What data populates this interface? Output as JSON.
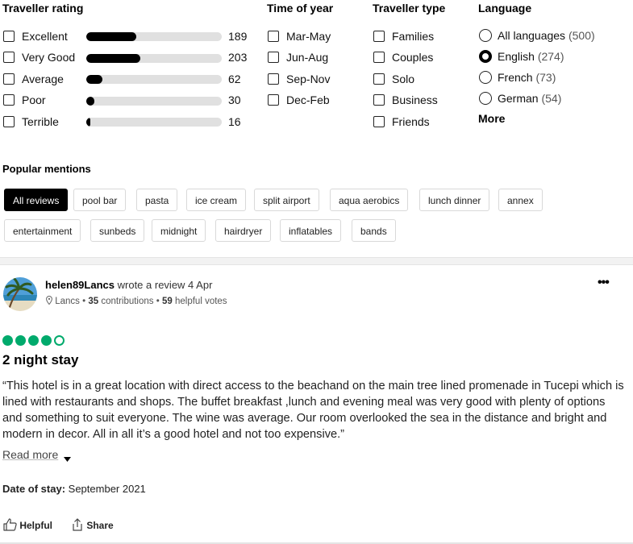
{
  "filters": {
    "rating": {
      "title": "Traveller rating",
      "items": [
        {
          "label": "Excellent",
          "count": "189",
          "share": 0.37
        },
        {
          "label": "Very Good",
          "count": "203",
          "share": 0.4
        },
        {
          "label": "Average",
          "count": "62",
          "share": 0.12
        },
        {
          "label": "Poor",
          "count": "30",
          "share": 0.06
        },
        {
          "label": "Terrible",
          "count": "16",
          "share": 0.03
        }
      ]
    },
    "time": {
      "title": "Time of year",
      "items": [
        "Mar-May",
        "Jun-Aug",
        "Sep-Nov",
        "Dec-Feb"
      ]
    },
    "type": {
      "title": "Traveller type",
      "items": [
        "Families",
        "Couples",
        "Solo",
        "Business",
        "Friends"
      ]
    },
    "language": {
      "title": "Language",
      "items": [
        {
          "label": "All languages",
          "count": "(500)",
          "selected": false
        },
        {
          "label": "English",
          "count": "(274)",
          "selected": true
        },
        {
          "label": "French",
          "count": "(73)",
          "selected": false
        },
        {
          "label": "German",
          "count": "(54)",
          "selected": false
        }
      ],
      "more": "More"
    }
  },
  "mentions": {
    "title": "Popular mentions",
    "chips": [
      "All reviews",
      "pool bar",
      "pasta",
      "ice cream",
      "split airport",
      "aqua aerobics",
      "lunch dinner",
      "annex",
      "entertainment",
      "sunbeds",
      "midnight",
      "hairdryer",
      "inflatables",
      "bands"
    ]
  },
  "review": {
    "username": "helen89Lancs",
    "wrote": "wrote a review 4 Apr",
    "location": "Lancs",
    "contributions_num": "35",
    "contributions_txt": "contributions",
    "helpful_num": "59",
    "helpful_txt": "helpful votes",
    "bullet": "•",
    "more_icon": "•••",
    "rating": 4,
    "rating_max": 5,
    "title": "2 night stay",
    "text": "“This hotel is in a great location with direct access to the beachand on the main tree lined promenade in Tucepi which is lined with restaurants and shops. The buffet breakfast ,lunch and evening meal was very good with plenty of options and something to suit everyone. The wine was average. Our room overlooked the sea in the distance and bright and modern in decor. All in all it’s a good hotel and not too expensive.”",
    "read_more": "Read more",
    "date_label": "Date of stay:",
    "date_value": "September 2021",
    "helpful_label": "Helpful",
    "share_label": "Share"
  },
  "colors": {
    "rating_green": "#00aa6c"
  }
}
